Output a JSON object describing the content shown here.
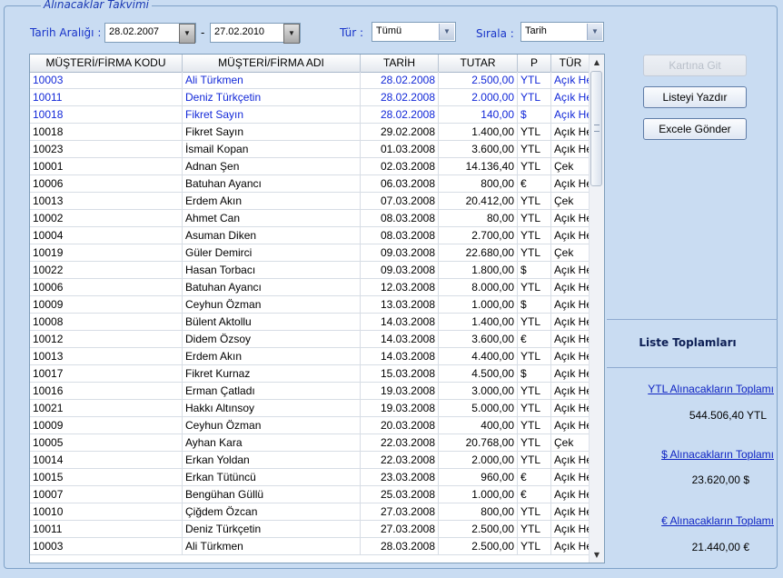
{
  "frame": {
    "legend": "Alınacaklar Takvimi"
  },
  "filters": {
    "date_range_label": "Tarih Aralığı :",
    "date_from": "28.02.2007",
    "date_separator": "-",
    "date_to": "27.02.2010",
    "type_label": "Tür :",
    "type_value": "Tümü",
    "sort_label": "Sırala :",
    "sort_value": "Tarih"
  },
  "buttons": {
    "card": "Kartına Git",
    "print": "Listeyi Yazdır",
    "excel": "Excele Gönder"
  },
  "table": {
    "headers": [
      "MÜŞTERİ/FİRMA KODU",
      "MÜŞTERİ/FİRMA ADI",
      "TARİH",
      "TUTAR",
      "P",
      "TÜR"
    ],
    "rows": [
      {
        "code": "10003",
        "name": "Ali Türkmen",
        "date": "28.02.2008",
        "amount": "2.500,00",
        "cur": "YTL",
        "type": "Açık Hesap",
        "sel": true
      },
      {
        "code": "10011",
        "name": "Deniz Türkçetin",
        "date": "28.02.2008",
        "amount": "2.000,00",
        "cur": "YTL",
        "type": "Açık Hesap",
        "sel": true
      },
      {
        "code": "10018",
        "name": "Fikret Sayın",
        "date": "28.02.2008",
        "amount": "140,00",
        "cur": "$",
        "type": "Açık Hesap",
        "sel": true
      },
      {
        "code": "10018",
        "name": "Fikret Sayın",
        "date": "29.02.2008",
        "amount": "1.400,00",
        "cur": "YTL",
        "type": "Açık Hesap"
      },
      {
        "code": "10023",
        "name": "İsmail Kopan",
        "date": "01.03.2008",
        "amount": "3.600,00",
        "cur": "YTL",
        "type": "Açık Hesap"
      },
      {
        "code": "10001",
        "name": "Adnan Şen",
        "date": "02.03.2008",
        "amount": "14.136,40",
        "cur": "YTL",
        "type": "Çek"
      },
      {
        "code": "10006",
        "name": "Batuhan Ayancı",
        "date": "06.03.2008",
        "amount": "800,00",
        "cur": "€",
        "type": "Açık Hesap"
      },
      {
        "code": "10013",
        "name": "Erdem Akın",
        "date": "07.03.2008",
        "amount": "20.412,00",
        "cur": "YTL",
        "type": "Çek"
      },
      {
        "code": "10002",
        "name": "Ahmet Can",
        "date": "08.03.2008",
        "amount": "80,00",
        "cur": "YTL",
        "type": "Açık Hesap"
      },
      {
        "code": "10004",
        "name": "Asuman Diken",
        "date": "08.03.2008",
        "amount": "2.700,00",
        "cur": "YTL",
        "type": "Açık Hesap"
      },
      {
        "code": "10019",
        "name": "Güler Demirci",
        "date": "09.03.2008",
        "amount": "22.680,00",
        "cur": "YTL",
        "type": "Çek"
      },
      {
        "code": "10022",
        "name": "Hasan Torbacı",
        "date": "09.03.2008",
        "amount": "1.800,00",
        "cur": "$",
        "type": "Açık Hesap"
      },
      {
        "code": "10006",
        "name": "Batuhan Ayancı",
        "date": "12.03.2008",
        "amount": "8.000,00",
        "cur": "YTL",
        "type": "Açık Hesap"
      },
      {
        "code": "10009",
        "name": "Ceyhun Özman",
        "date": "13.03.2008",
        "amount": "1.000,00",
        "cur": "$",
        "type": "Açık Hesap"
      },
      {
        "code": "10008",
        "name": "Bülent Aktollu",
        "date": "14.03.2008",
        "amount": "1.400,00",
        "cur": "YTL",
        "type": "Açık Hesap"
      },
      {
        "code": "10012",
        "name": "Didem Özsoy",
        "date": "14.03.2008",
        "amount": "3.600,00",
        "cur": "€",
        "type": "Açık Hesap"
      },
      {
        "code": "10013",
        "name": "Erdem Akın",
        "date": "14.03.2008",
        "amount": "4.400,00",
        "cur": "YTL",
        "type": "Açık Hesap"
      },
      {
        "code": "10017",
        "name": "Fikret Kurnaz",
        "date": "15.03.2008",
        "amount": "4.500,00",
        "cur": "$",
        "type": "Açık Hesap"
      },
      {
        "code": "10016",
        "name": "Erman Çatladı",
        "date": "19.03.2008",
        "amount": "3.000,00",
        "cur": "YTL",
        "type": "Açık Hesap"
      },
      {
        "code": "10021",
        "name": "Hakkı Altınsoy",
        "date": "19.03.2008",
        "amount": "5.000,00",
        "cur": "YTL",
        "type": "Açık Hesap"
      },
      {
        "code": "10009",
        "name": "Ceyhun Özman",
        "date": "20.03.2008",
        "amount": "400,00",
        "cur": "YTL",
        "type": "Açık Hesap"
      },
      {
        "code": "10005",
        "name": "Ayhan Kara",
        "date": "22.03.2008",
        "amount": "20.768,00",
        "cur": "YTL",
        "type": "Çek"
      },
      {
        "code": "10014",
        "name": "Erkan Yoldan",
        "date": "22.03.2008",
        "amount": "2.000,00",
        "cur": "YTL",
        "type": "Açık Hesap"
      },
      {
        "code": "10015",
        "name": "Erkan Tütüncü",
        "date": "23.03.2008",
        "amount": "960,00",
        "cur": "€",
        "type": "Açık Hesap"
      },
      {
        "code": "10007",
        "name": "Bengühan Güllü",
        "date": "25.03.2008",
        "amount": "1.000,00",
        "cur": "€",
        "type": "Açık Hesap"
      },
      {
        "code": "10010",
        "name": "Çiğdem Özcan",
        "date": "27.03.2008",
        "amount": "800,00",
        "cur": "YTL",
        "type": "Açık Hesap"
      },
      {
        "code": "10011",
        "name": "Deniz Türkçetin",
        "date": "27.03.2008",
        "amount": "2.500,00",
        "cur": "YTL",
        "type": "Açık Hesap"
      },
      {
        "code": "10003",
        "name": "Ali Türkmen",
        "date": "28.03.2008",
        "amount": "2.500,00",
        "cur": "YTL",
        "type": "Açık Hesap"
      }
    ]
  },
  "summary": {
    "title": "Liste Toplamları",
    "ytl_label": "YTL  Alınacakların Toplamı",
    "ytl_value": "544.506,40 YTL",
    "usd_label": "$  Alınacakların Toplamı",
    "usd_value": "23.620,00 $",
    "eur_label": "€  Alınacakların Toplamı",
    "eur_value": "21.440,00 €"
  },
  "colors": {
    "background": "#c9dcf2",
    "label_blue": "#1733c9",
    "selected_text": "#1228d8",
    "link": "#0e23c3"
  },
  "icons": {
    "combo_dropdown": "chevron-down-icon",
    "scroll_up": "arrow-up-icon",
    "scroll_down": "arrow-down-icon"
  }
}
